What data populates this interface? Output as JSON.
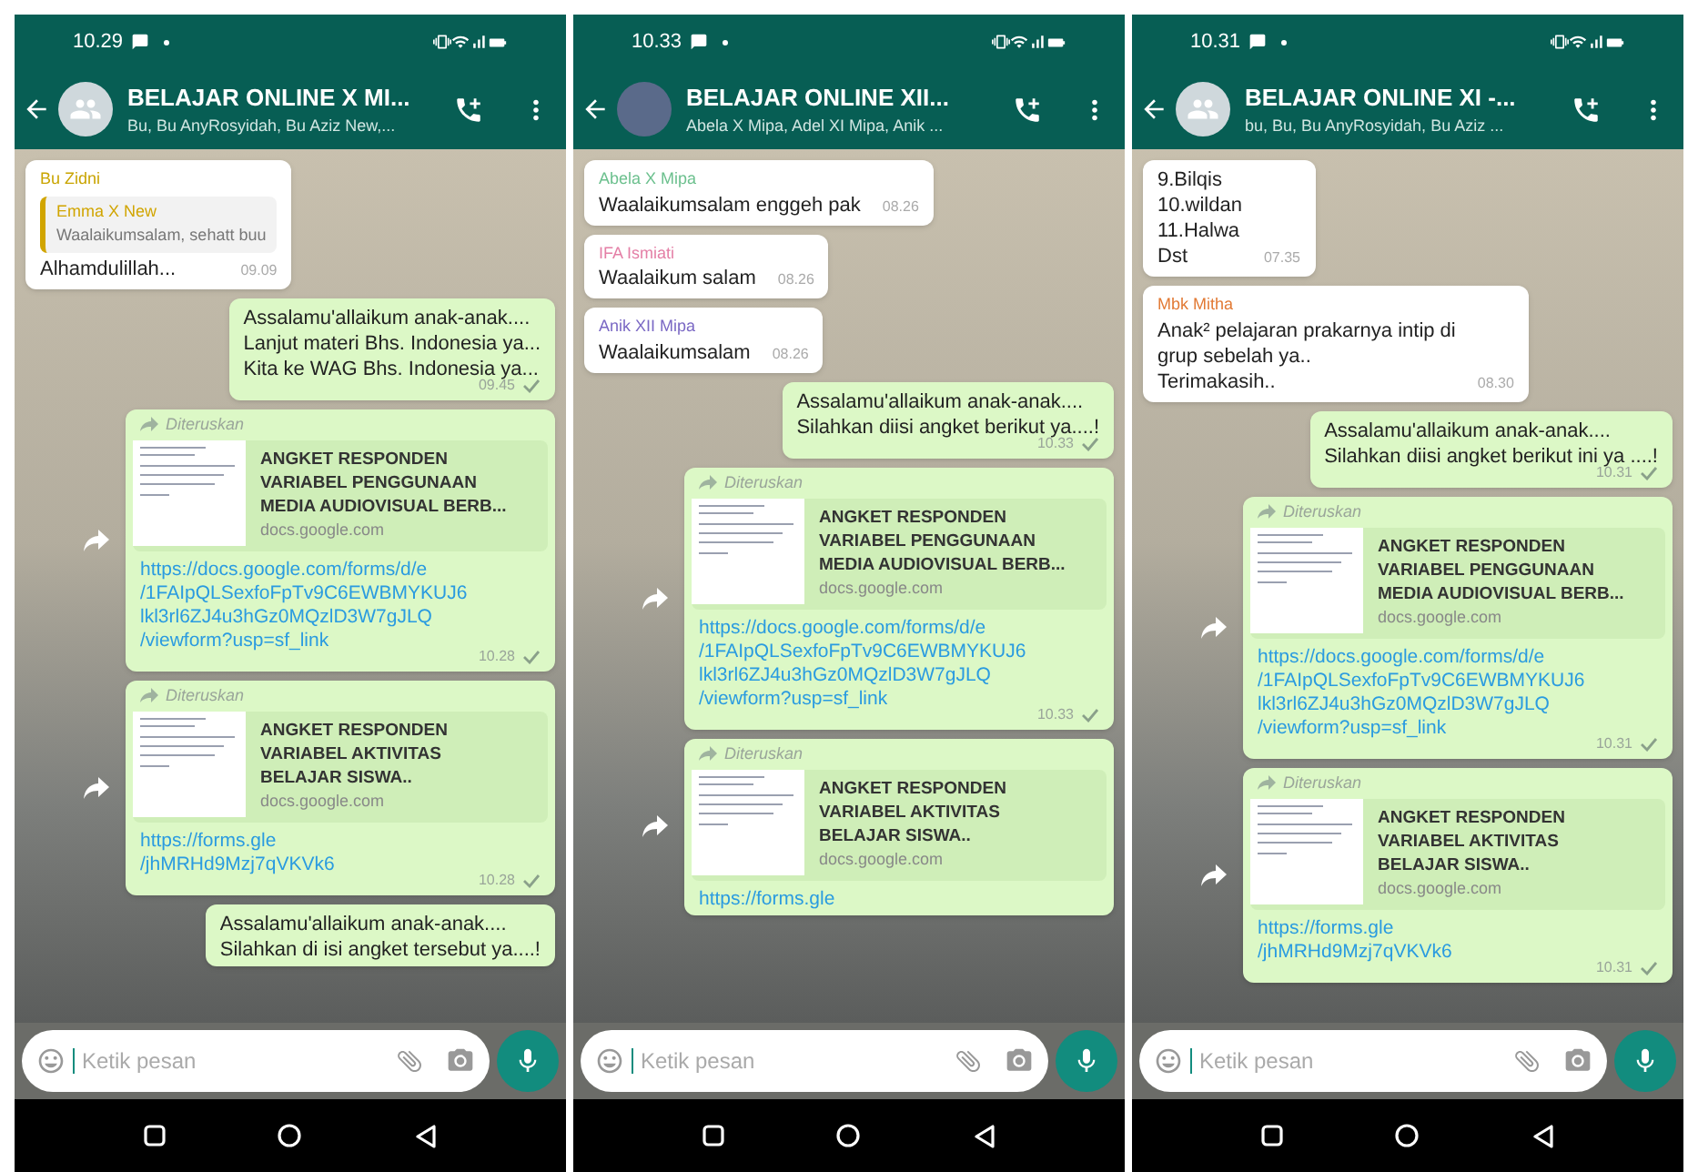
{
  "phones": [
    {
      "status_bar": {
        "time": "10.29"
      },
      "header": {
        "title": "BELAJAR ONLINE X MI...",
        "subtitle": "Bu, Bu AnyRosyidah, Bu Aziz New,...",
        "has_photo": false
      },
      "messages": [
        {
          "kind": "incoming",
          "sender": "Bu Zidni",
          "color": "#c9a400",
          "quote": {
            "sender": "Emma X New",
            "color": "#d1a500",
            "text": "Waalaikumsalam, sehatt buu"
          },
          "lines": [
            "Alhamdulillah..."
          ],
          "time": "09.09"
        },
        {
          "kind": "outgoing",
          "lines": [
            "Assalamu'allaikum anak-anak....",
            "Lanjut materi Bhs. Indonesia ya...",
            "Kita ke WAG Bhs. Indonesia ya..."
          ],
          "time": "09.45",
          "delivered": false
        },
        {
          "kind": "forwarded_link",
          "forwarded_label": "Diteruskan",
          "title_lines": [
            "ANGKET RESPONDEN",
            "VARIABEL PENGGUNAAN",
            "MEDIA AUDIOVISUAL BERB..."
          ],
          "domain": "docs.google.com",
          "url_lines": [
            "https://docs.google.com/forms/d/e",
            "/1FAIpQLSexfoFpTv9C6EWBMYKUJ6",
            "lkl3rl6ZJ4u3hGz0MQzlD3W7gJLQ",
            "/viewform?usp=sf_link"
          ],
          "time": "10.28",
          "delivered": false
        },
        {
          "kind": "forwarded_link",
          "forwarded_label": "Diteruskan",
          "title_lines": [
            "ANGKET RESPONDEN",
            "VARIABEL AKTIVITAS",
            "BELAJAR SISWA.."
          ],
          "domain": "docs.google.com",
          "url_lines": [
            "https://forms.gle",
            "/jhMRHd9Mzj7qVKVk6"
          ],
          "time": "10.28",
          "delivered": false
        },
        {
          "kind": "outgoing",
          "lines": [
            "Assalamu'allaikum anak-anak....",
            "Silahkan di isi angket tersebut ya....!"
          ]
        }
      ],
      "input": {
        "placeholder": "Ketik pesan"
      }
    },
    {
      "status_bar": {
        "time": "10.33"
      },
      "header": {
        "title": "BELAJAR ONLINE  XII...",
        "subtitle": "Abela X Mipa, Adel XI Mipa, Anik ...",
        "has_photo": true
      },
      "messages": [
        {
          "kind": "incoming",
          "sender": "Abela X Mipa",
          "color": "#6cc08e",
          "lines": [
            "Waalaikumsalam enggeh pak"
          ],
          "time": "08.26"
        },
        {
          "kind": "incoming",
          "sender": "IFA Ismiati",
          "color": "#e47fa6",
          "lines": [
            "Waalaikum salam"
          ],
          "time": "08.26"
        },
        {
          "kind": "incoming",
          "sender": "Anik XII Mipa",
          "color": "#7a68c4",
          "lines": [
            "Waalaikumsalam"
          ],
          "time": "08.26"
        },
        {
          "kind": "outgoing",
          "lines": [
            "Assalamu'allaikum anak-anak....",
            "Silahkan diisi angket berikut ya....!"
          ],
          "time": "10.33",
          "delivered": false
        },
        {
          "kind": "forwarded_link",
          "forwarded_label": "Diteruskan",
          "title_lines": [
            "ANGKET RESPONDEN",
            "VARIABEL PENGGUNAAN",
            "MEDIA AUDIOVISUAL BERB..."
          ],
          "domain": "docs.google.com",
          "url_lines": [
            "https://docs.google.com/forms/d/e",
            "/1FAIpQLSexfoFpTv9C6EWBMYKUJ6",
            "lkl3rl6ZJ4u3hGz0MQzlD3W7gJLQ",
            "/viewform?usp=sf_link"
          ],
          "time": "10.33",
          "delivered": false
        },
        {
          "kind": "forwarded_link",
          "forwarded_label": "Diteruskan",
          "title_lines": [
            "ANGKET RESPONDEN",
            "VARIABEL AKTIVITAS",
            "BELAJAR SISWA.."
          ],
          "domain": "docs.google.com",
          "url_lines": [
            "https://forms.gle"
          ]
        }
      ],
      "input": {
        "placeholder": "Ketik pesan"
      }
    },
    {
      "status_bar": {
        "time": "10.31"
      },
      "header": {
        "title": "BELAJAR ONLINE XI -...",
        "subtitle": "bu, Bu, Bu AnyRosyidah, Bu Aziz ...",
        "has_photo": false
      },
      "messages": [
        {
          "kind": "incoming",
          "lines": [
            "9.Bilqis",
            "10.wildan",
            "11.Halwa",
            "Dst"
          ],
          "time": "07.35"
        },
        {
          "kind": "incoming",
          "sender": "Mbk Mitha",
          "color": "#e27a35",
          "lines": [
            "Anak² pelajaran prakarnya intip di",
            "grup sebelah ya..",
            "Terimakasih.."
          ],
          "time": "08.30"
        },
        {
          "kind": "outgoing",
          "lines": [
            "Assalamu'allaikum anak-anak....",
            "Silahkan diisi angket berikut ini ya ....!"
          ],
          "time": "10.31",
          "delivered": false
        },
        {
          "kind": "forwarded_link",
          "forwarded_label": "Diteruskan",
          "title_lines": [
            "ANGKET RESPONDEN",
            "VARIABEL PENGGUNAAN",
            "MEDIA AUDIOVISUAL BERB..."
          ],
          "domain": "docs.google.com",
          "url_lines": [
            "https://docs.google.com/forms/d/e",
            "/1FAIpQLSexfoFpTv9C6EWBMYKUJ6",
            "lkl3rl6ZJ4u3hGz0MQzlD3W7gJLQ",
            "/viewform?usp=sf_link"
          ],
          "time": "10.31",
          "delivered": false
        },
        {
          "kind": "forwarded_link",
          "forwarded_label": "Diteruskan",
          "title_lines": [
            "ANGKET RESPONDEN",
            "VARIABEL AKTIVITAS",
            "BELAJAR SISWA.."
          ],
          "domain": "docs.google.com",
          "url_lines": [
            "https://forms.gle",
            "/jhMRHd9Mzj7qVKVk6"
          ],
          "time": "10.31",
          "delivered": false
        }
      ],
      "input": {
        "placeholder": "Ketik pesan"
      }
    }
  ]
}
